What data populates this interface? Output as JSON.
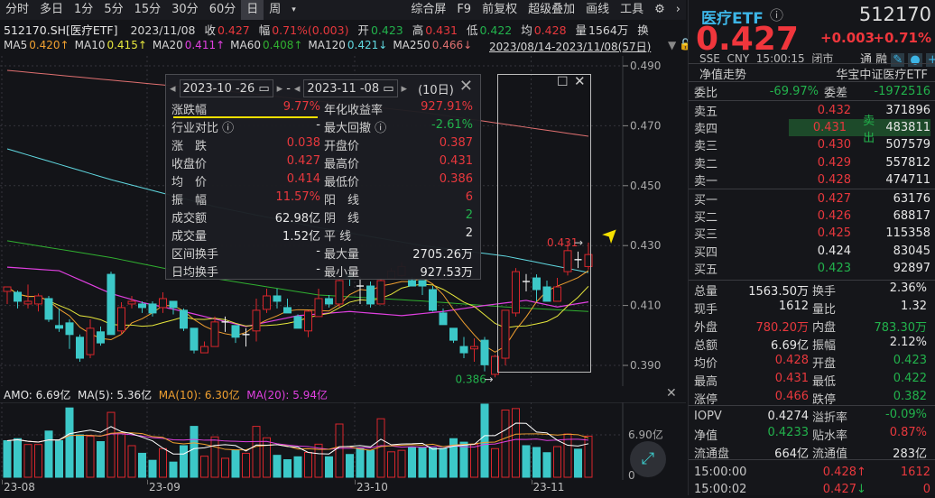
{
  "toolbar": {
    "periods": [
      "分时",
      "多日",
      "1分",
      "5分",
      "15分",
      "30分",
      "60分",
      "日",
      "周"
    ],
    "selected": "日",
    "right": [
      "综合屏",
      "F9",
      "前复权",
      "超级叠加",
      "画线",
      "工具"
    ]
  },
  "info": {
    "code": "512170.SH[医疗ETF]",
    "date": "2023/11/08",
    "close_label": "收",
    "close": "0.427",
    "chg_label": "幅",
    "chg": "0.71%(0.003)",
    "open_label": "开",
    "open": "0.423",
    "high_label": "高",
    "high": "0.431",
    "low_label": "低",
    "low": "0.422",
    "avg_label": "均",
    "avg": "0.428",
    "vol_label": "量",
    "vol": "1564万",
    "turn_label": "换"
  },
  "ma": [
    {
      "name": "MA5",
      "value": "0.420↑",
      "color": "#f0a030"
    },
    {
      "name": "MA10",
      "value": "0.415↑",
      "color": "#e6e63c"
    },
    {
      "name": "MA20",
      "value": "0.411↑",
      "color": "#e040e0"
    },
    {
      "name": "MA60",
      "value": "0.408↑",
      "color": "#30b030"
    },
    {
      "name": "MA120",
      "value": "0.421↓",
      "color": "#60d8e0"
    },
    {
      "name": "MA250",
      "value": "0.466↓",
      "color": "#e07070"
    }
  ],
  "range": "2023/08/14-2023/11/08(57日)",
  "popup": {
    "start": "2023-10 -26",
    "dash": "-",
    "end": "2023-11 -08",
    "days": "(10日)",
    "rows": [
      [
        {
          "k": "涨跌幅",
          "v": "9.77%",
          "c": "red"
        },
        {
          "k": "年化收益率",
          "v": "927.91%",
          "c": "red"
        }
      ],
      [
        {
          "k": "行业对比 ⓘ",
          "v": "-",
          "c": "white"
        },
        {
          "k": "最大回撤 ⓘ",
          "v": "-2.61%",
          "c": "green"
        }
      ],
      [
        {
          "k": "涨　跌",
          "v": "0.038",
          "c": "red"
        },
        {
          "k": "开盘价",
          "v": "0.387",
          "c": "red"
        }
      ],
      [
        {
          "k": "收盘价",
          "v": "0.427",
          "c": "red"
        },
        {
          "k": "最高价",
          "v": "0.431",
          "c": "red"
        }
      ],
      [
        {
          "k": "均　价",
          "v": "0.414",
          "c": "red"
        },
        {
          "k": "最低价",
          "v": "0.386",
          "c": "red"
        }
      ],
      [
        {
          "k": "振　幅",
          "v": "11.57%",
          "c": "red"
        },
        {
          "k": "阳　线",
          "v": "6",
          "c": "red"
        }
      ],
      [
        {
          "k": "成交额",
          "v": "62.98亿",
          "c": "white"
        },
        {
          "k": "阴　线",
          "v": "2",
          "c": "green"
        }
      ],
      [
        {
          "k": "成交量",
          "v": "1.52亿",
          "c": "white"
        },
        {
          "k": "平 线",
          "v": "2",
          "c": "white"
        }
      ],
      [
        {
          "k": "区间换手",
          "v": "-",
          "c": "white"
        },
        {
          "k": "最大量",
          "v": "2705.26万",
          "c": "white"
        }
      ],
      [
        {
          "k": "日均换手",
          "v": "-",
          "c": "white"
        },
        {
          "k": "最小量",
          "v": "927.53万",
          "c": "white"
        }
      ]
    ]
  },
  "amo": {
    "amo": "AMO: 6.69亿",
    "ma5": "MA(5): 5.36亿",
    "ma10": "MA(10): 6.30亿",
    "ma20": "MA(20): 5.94亿"
  },
  "chart_data": {
    "type": "candlestick",
    "price_ticks": [
      "0.490",
      "0.470",
      "0.450",
      "0.430",
      "0.410",
      "0.390"
    ],
    "ylim": [
      0.383,
      0.4925
    ],
    "high_mark": "0.431",
    "low_mark": "0.386",
    "vol_ticks": [
      "6.90亿",
      "0"
    ],
    "vol_unit_max": 12.3,
    "date_labels": [
      {
        "label": "23-08",
        "index": 0
      },
      {
        "label": "23-09",
        "index": 14
      },
      {
        "label": "23-10",
        "index": 34
      },
      {
        "label": "23-11",
        "index": 51
      }
    ],
    "ohlc": [
      [
        0.4147,
        0.4162,
        0.4105,
        0.4162
      ],
      [
        0.4144,
        0.415,
        0.409,
        0.4114
      ],
      [
        0.4105,
        0.417,
        0.409,
        0.4114
      ],
      [
        0.4105,
        0.414,
        0.408,
        0.4132
      ],
      [
        0.4123,
        0.4132,
        0.4045,
        0.4054
      ],
      [
        0.4033,
        0.409,
        0.4012,
        0.4024
      ],
      [
        0.4042,
        0.4054,
        0.3955,
        0.4003
      ],
      [
        0.3994,
        0.4003,
        0.3912,
        0.3924
      ],
      [
        0.3936,
        0.4054,
        0.3924,
        0.4024
      ],
      [
        0.4012,
        0.403,
        0.3966,
        0.3975
      ],
      [
        0.4204,
        0.4213,
        0.4003,
        0.4003
      ],
      [
        0.4015,
        0.4111,
        0.4003,
        0.4093
      ],
      [
        0.4105,
        0.4132,
        0.409,
        0.4114
      ],
      [
        0.4105,
        0.4114,
        0.4075,
        0.4093
      ],
      [
        0.4105,
        0.4114,
        0.4063,
        0.4075
      ],
      [
        0.4093,
        0.4144,
        0.4075,
        0.4123
      ],
      [
        0.4114,
        0.4114,
        0.407,
        0.4093
      ],
      [
        0.4084,
        0.409,
        0.4015,
        0.4024
      ],
      [
        0.4024,
        0.4024,
        0.394,
        0.3951
      ],
      [
        0.3942,
        0.398,
        0.3942,
        0.3963
      ],
      [
        0.3963,
        0.4063,
        0.3963,
        0.4045
      ],
      [
        0.4045,
        0.4063,
        0.4012,
        0.4045
      ],
      [
        0.4033,
        0.4033,
        0.3975,
        0.3994
      ],
      [
        0.4003,
        0.4024,
        0.3963,
        0.4003
      ],
      [
        0.4015,
        0.4123,
        0.398,
        0.4084
      ],
      [
        0.4087,
        0.4156,
        0.4075,
        0.4132
      ],
      [
        0.4132,
        0.4156,
        0.409,
        0.4114
      ],
      [
        0.4093,
        0.4123,
        0.4075,
        0.4075
      ],
      [
        0.4063,
        0.407,
        0.4024,
        0.4024
      ],
      [
        0.4015,
        0.4084,
        0.3994,
        0.4081
      ],
      [
        0.4063,
        0.4156,
        0.4063,
        0.4123
      ],
      [
        0.4123,
        0.4135,
        0.4093,
        0.4105
      ],
      [
        0.4105,
        0.419,
        0.4093,
        0.4183
      ],
      [
        0.4205,
        0.422,
        0.4165,
        0.419
      ],
      [
        0.4165,
        0.4195,
        0.4105,
        0.4165
      ],
      [
        0.4165,
        0.418,
        0.4093,
        0.4105
      ],
      [
        0.4105,
        0.419,
        0.4105,
        0.4183
      ],
      [
        0.419,
        0.4225,
        0.4188,
        0.4215
      ],
      [
        0.42,
        0.4245,
        0.4195,
        0.423
      ],
      [
        0.4183,
        0.4195,
        0.4165,
        0.4165
      ],
      [
        0.4183,
        0.4183,
        0.4135,
        0.4165
      ],
      [
        0.4153,
        0.4165,
        0.408,
        0.4084
      ],
      [
        0.4075,
        0.409,
        0.4036,
        0.4036
      ],
      [
        0.4024,
        0.4024,
        0.3975,
        0.3984
      ],
      [
        0.3963,
        0.3995,
        0.3924,
        0.3942
      ],
      [
        0.3955,
        0.399,
        0.3912,
        0.3963
      ],
      [
        0.3984,
        0.3995,
        0.388,
        0.3902
      ],
      [
        0.387,
        0.3935,
        0.386,
        0.393
      ],
      [
        0.3924,
        0.4084,
        0.39,
        0.4084
      ],
      [
        0.4075,
        0.4225,
        0.4063,
        0.4213
      ],
      [
        0.418,
        0.4205,
        0.4147,
        0.418
      ],
      [
        0.4192,
        0.4204,
        0.4114,
        0.4153
      ],
      [
        0.4162,
        0.4183,
        0.4114,
        0.4114
      ],
      [
        0.4114,
        0.4192,
        0.4114,
        0.4162
      ],
      [
        0.4213,
        0.431,
        0.42,
        0.4283
      ],
      [
        0.4253,
        0.428,
        0.4225,
        0.4253
      ],
      [
        0.423,
        0.431,
        0.422,
        0.427
      ]
    ],
    "volume_yi": [
      5.95,
      6.28,
      5.33,
      5.33,
      7.52,
      5.95,
      11.28,
      6.9,
      6.66,
      5.8,
      10.56,
      7.23,
      5.14,
      3.9,
      2.76,
      4.66,
      2.47,
      5.14,
      8.28,
      3.43,
      6.57,
      3.09,
      4.38,
      3.9,
      8.28,
      6.42,
      3.57,
      2.86,
      3.33,
      4.04,
      5.38,
      3.33,
      8.66,
      3.71,
      4.66,
      4.38,
      9.52,
      4.14,
      4.38,
      4.85,
      4.76,
      4.76,
      4.66,
      6.28,
      5.71,
      5.33,
      11.9,
      4.66,
      10.94,
      11.18,
      5.14,
      4.85,
      4.0,
      4.99,
      7.04,
      4.57,
      6.69
    ],
    "volume_up": [
      0,
      0,
      1,
      1,
      0,
      0,
      0,
      0,
      1,
      0,
      1,
      1,
      1,
      0,
      0,
      1,
      0,
      0,
      0,
      1,
      1,
      1,
      0,
      1,
      1,
      1,
      0,
      0,
      0,
      1,
      1,
      0,
      1,
      0,
      0,
      0,
      1,
      1,
      1,
      0,
      0,
      0,
      0,
      0,
      0,
      1,
      0,
      1,
      1,
      1,
      0,
      0,
      0,
      1,
      1,
      0,
      1
    ],
    "ma_samples": {
      "ma20": [
        [
          0,
          0.4228
        ],
        [
          5,
          0.4216
        ],
        [
          10,
          0.414
        ],
        [
          13,
          0.411
        ],
        [
          17,
          0.408
        ],
        [
          23,
          0.403
        ],
        [
          28,
          0.4066
        ],
        [
          33,
          0.408
        ],
        [
          38,
          0.4066
        ],
        [
          42,
          0.408
        ],
        [
          46,
          0.41
        ],
        [
          50,
          0.4117
        ],
        [
          53,
          0.4095
        ],
        [
          56,
          0.4112
        ]
      ],
      "ma60": [
        [
          0,
          0.4316
        ],
        [
          10,
          0.426
        ],
        [
          20,
          0.419
        ],
        [
          30,
          0.4135
        ],
        [
          40,
          0.4115
        ],
        [
          48,
          0.4095
        ],
        [
          56,
          0.408
        ]
      ],
      "ma120": [
        [
          0,
          0.4623
        ],
        [
          10,
          0.452
        ],
        [
          20,
          0.443
        ],
        [
          30,
          0.436
        ],
        [
          40,
          0.43
        ],
        [
          48,
          0.4265
        ],
        [
          56,
          0.421
        ]
      ],
      "ma250": [
        [
          0,
          0.4885
        ],
        [
          20,
          0.482
        ],
        [
          40,
          0.4745
        ],
        [
          56,
          0.4665
        ]
      ]
    }
  },
  "quote": {
    "name": "医疗ETF",
    "code": "512170",
    "price": "0.427",
    "change": "+0.003",
    "pct": "+0.71%",
    "exchange": "SSE",
    "currency": "CNY",
    "time": "15:00:15",
    "status": "闭市",
    "tong": "通",
    "rong": "融",
    "nav_trend": "净值走势",
    "fund_name": "华宝中证医疗ETF",
    "weibi_label": "委比",
    "weibi": "-69.97%",
    "weicha_label": "委差",
    "weicha": "-1972516",
    "asks": [
      {
        "l": "卖五",
        "p": "0.432",
        "v": "371896",
        "c": "red"
      },
      {
        "l": "卖四",
        "p": "0.431",
        "v": "483811",
        "c": "red",
        "tag": "卖出"
      },
      {
        "l": "卖三",
        "p": "0.430",
        "v": "507579",
        "c": "red"
      },
      {
        "l": "卖二",
        "p": "0.429",
        "v": "557812",
        "c": "red"
      },
      {
        "l": "卖一",
        "p": "0.428",
        "v": "474711",
        "c": "red"
      }
    ],
    "bids": [
      {
        "l": "买一",
        "p": "0.427",
        "v": "63176",
        "c": "red"
      },
      {
        "l": "买二",
        "p": "0.426",
        "v": "68817",
        "c": "red"
      },
      {
        "l": "买三",
        "p": "0.425",
        "v": "115358",
        "c": "red"
      },
      {
        "l": "买四",
        "p": "0.424",
        "v": "83045",
        "c": "white"
      },
      {
        "l": "买五",
        "p": "0.423",
        "v": "92897",
        "c": "green"
      }
    ],
    "stats": [
      [
        {
          "k": "总量",
          "v": "1563.50万",
          "c": "white"
        },
        {
          "k": "换手",
          "v": "2.36%",
          "c": "white"
        }
      ],
      [
        {
          "k": "现手",
          "v": "1612",
          "c": "white"
        },
        {
          "k": "量比",
          "v": "1.32",
          "c": "white"
        }
      ],
      [
        {
          "k": "外盘",
          "v": "780.20万",
          "c": "red"
        },
        {
          "k": "内盘",
          "v": "783.30万",
          "c": "green"
        }
      ],
      [
        {
          "k": "总额",
          "v": "6.69亿",
          "c": "white"
        },
        {
          "k": "振幅",
          "v": "2.12%",
          "c": "white"
        }
      ],
      [
        {
          "k": "均价",
          "v": "0.428",
          "c": "red"
        },
        {
          "k": "开盘",
          "v": "0.423",
          "c": "green"
        }
      ],
      [
        {
          "k": "最高",
          "v": "0.431",
          "c": "red"
        },
        {
          "k": "最低",
          "v": "0.422",
          "c": "green"
        }
      ],
      [
        {
          "k": "涨停",
          "v": "0.466",
          "c": "red"
        },
        {
          "k": "跌停",
          "v": "0.382",
          "c": "green"
        }
      ]
    ],
    "stats2": [
      [
        {
          "k": "IOPV",
          "v": "0.4274",
          "c": "white"
        },
        {
          "k": "溢折率",
          "v": "-0.09%",
          "c": "green"
        }
      ],
      [
        {
          "k": "净值",
          "v": "0.4233",
          "c": "green"
        },
        {
          "k": "贴水率",
          "v": "0.87%",
          "c": "red"
        }
      ],
      [
        {
          "k": "流通盘",
          "v": "664亿",
          "c": "white"
        },
        {
          "k": "流通值",
          "v": "283亿",
          "c": "white"
        }
      ]
    ],
    "ticks": [
      {
        "t": "15:00:00",
        "p": "0.428",
        "dir": "↑",
        "v": "1612",
        "c": "red",
        "vc": "red"
      },
      {
        "t": "15:00:02",
        "p": "0.427",
        "dir": "↓",
        "v": "0",
        "c": "red",
        "vc": "red"
      }
    ]
  }
}
